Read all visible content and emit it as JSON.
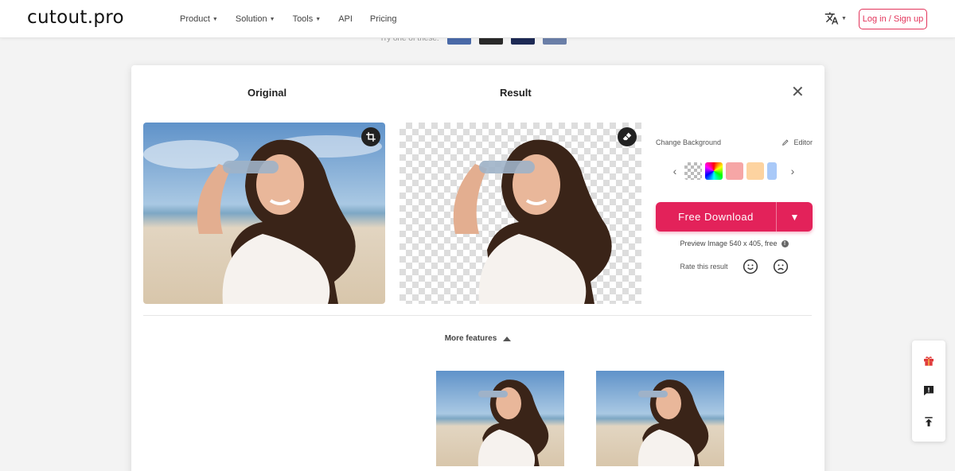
{
  "header": {
    "logo": "cutout.pro",
    "nav": [
      {
        "label": "Product",
        "has_caret": true
      },
      {
        "label": "Solution",
        "has_caret": true
      },
      {
        "label": "Tools",
        "has_caret": true
      },
      {
        "label": "API",
        "has_caret": false
      },
      {
        "label": "Pricing",
        "has_caret": false
      }
    ],
    "language_icon": "translate-icon",
    "login_label": "Log in / Sign up"
  },
  "try_strip": {
    "label": "Try one of these:"
  },
  "modal": {
    "original_title": "Original",
    "result_title": "Result",
    "close_icon": "close-icon",
    "crop_icon": "crop-icon",
    "eraser_icon": "eraser-icon",
    "panel": {
      "change_background_label": "Change Background",
      "editor_label": "Editor",
      "swatch_colors": [
        "transparent",
        "rainbow",
        "#f6a6a6",
        "#fdd3a0",
        "#a9c9f8"
      ],
      "download_label": "Free Download",
      "preview_text": "Preview Image 540 x 405, free",
      "rate_label": "Rate this result"
    },
    "more_features_label": "More features"
  },
  "colors": {
    "accent": "#e3225a",
    "login_border": "#e3345b"
  },
  "side_toolbar": [
    "gift-icon",
    "feedback-icon",
    "back-to-top-icon"
  ]
}
